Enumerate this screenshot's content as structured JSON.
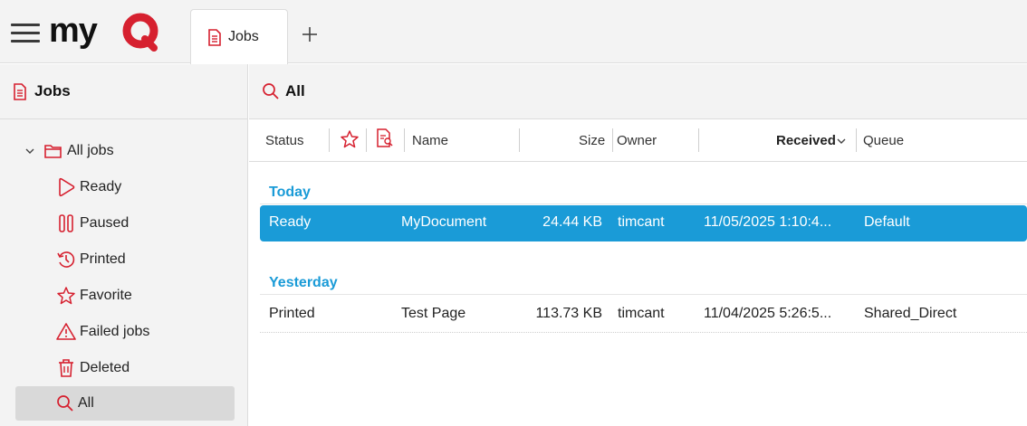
{
  "app": {
    "logo_text": "myQ"
  },
  "tabs": [
    {
      "label": "Jobs"
    }
  ],
  "sidebar": {
    "title": "Jobs",
    "items": [
      {
        "label": "All jobs",
        "icon": "folder-icon"
      },
      {
        "label": "Ready",
        "icon": "play-icon"
      },
      {
        "label": "Paused",
        "icon": "pause-icon"
      },
      {
        "label": "Printed",
        "icon": "history-icon"
      },
      {
        "label": "Favorite",
        "icon": "star-icon"
      },
      {
        "label": "Failed jobs",
        "icon": "warning-icon"
      },
      {
        "label": "Deleted",
        "icon": "trash-icon"
      },
      {
        "label": "All",
        "icon": "search-icon"
      }
    ],
    "selected": "All"
  },
  "main": {
    "title": "All",
    "columns": {
      "status": "Status",
      "name": "Name",
      "size": "Size",
      "owner": "Owner",
      "received": "Received",
      "queue": "Queue"
    },
    "groups": [
      {
        "label": "Today",
        "rows": [
          {
            "status": "Ready",
            "name": "MyDocument",
            "size": "24.44 KB",
            "owner": "timcant",
            "received": "11/05/2025 1:10:4...",
            "queue": "Default",
            "selected": true
          }
        ]
      },
      {
        "label": "Yesterday",
        "rows": [
          {
            "status": "Printed",
            "name": "Test Page",
            "size": "113.73 KB",
            "owner": "timcant",
            "received": "11/04/2025 5:26:5...",
            "queue": "Shared_Direct",
            "selected": false
          }
        ]
      }
    ]
  },
  "colors": {
    "accent": "#d6202f",
    "selection": "#1a9bd7",
    "panel": "#f3f3f3"
  }
}
